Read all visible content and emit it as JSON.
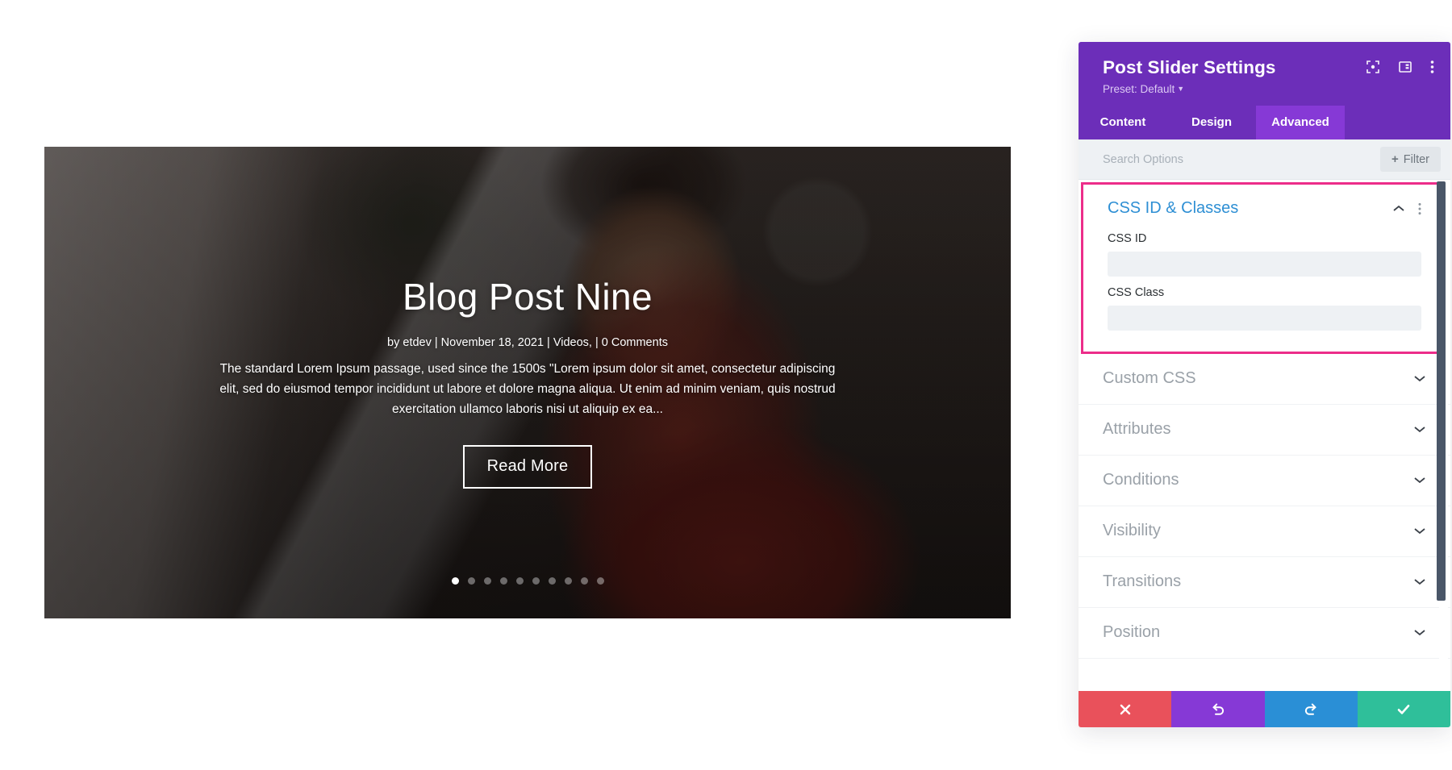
{
  "slider": {
    "title": "Blog Post Nine",
    "meta": "by etdev  |  November 18, 2021  |  Videos,  |  0 Comments",
    "body": "The standard Lorem Ipsum passage, used since the 1500s \"Lorem ipsum dolor sit amet, consectetur adipiscing elit, sed do eiusmod tempor incididunt ut labore et dolore magna aliqua. Ut enim ad minim veniam, quis nostrud exercitation ullamco laboris nisi ut aliquip ex ea...",
    "read_more_label": "Read More",
    "dots_total": 10,
    "dots_active_index": 0
  },
  "panel": {
    "title": "Post Slider Settings",
    "preset_label": "Preset: Default",
    "header_icons": [
      {
        "name": "focus-target-icon"
      },
      {
        "name": "layout-panel-icon"
      },
      {
        "name": "kebab-menu-icon"
      }
    ],
    "tabs": [
      {
        "label": "Content",
        "active": false
      },
      {
        "label": "Design",
        "active": false
      },
      {
        "label": "Advanced",
        "active": true
      }
    ],
    "search": {
      "value": "",
      "placeholder": "Search Options"
    },
    "filter_button_label": "Filter",
    "open_group": {
      "title": "CSS ID & Classes",
      "fields": [
        {
          "label": "CSS ID",
          "value": "",
          "placeholder": ""
        },
        {
          "label": "CSS Class",
          "value": "",
          "placeholder": ""
        }
      ]
    },
    "accordions": [
      {
        "label": "Custom CSS"
      },
      {
        "label": "Attributes"
      },
      {
        "label": "Conditions"
      },
      {
        "label": "Visibility"
      },
      {
        "label": "Transitions"
      },
      {
        "label": "Position"
      }
    ],
    "footer_buttons": [
      {
        "name": "cancel-button",
        "icon": "close-icon"
      },
      {
        "name": "undo-button",
        "icon": "undo-icon"
      },
      {
        "name": "redo-button",
        "icon": "redo-icon"
      },
      {
        "name": "save-button",
        "icon": "check-icon"
      }
    ]
  },
  "colors": {
    "panel_header": "#6c2eb9",
    "tab_active": "#8639d6",
    "highlight_border": "#ec2d8a",
    "group_title": "#2e8fd4",
    "cancel": "#e9515b",
    "undo": "#8639d6",
    "redo": "#2a8fd6",
    "save": "#2fbf9a"
  }
}
